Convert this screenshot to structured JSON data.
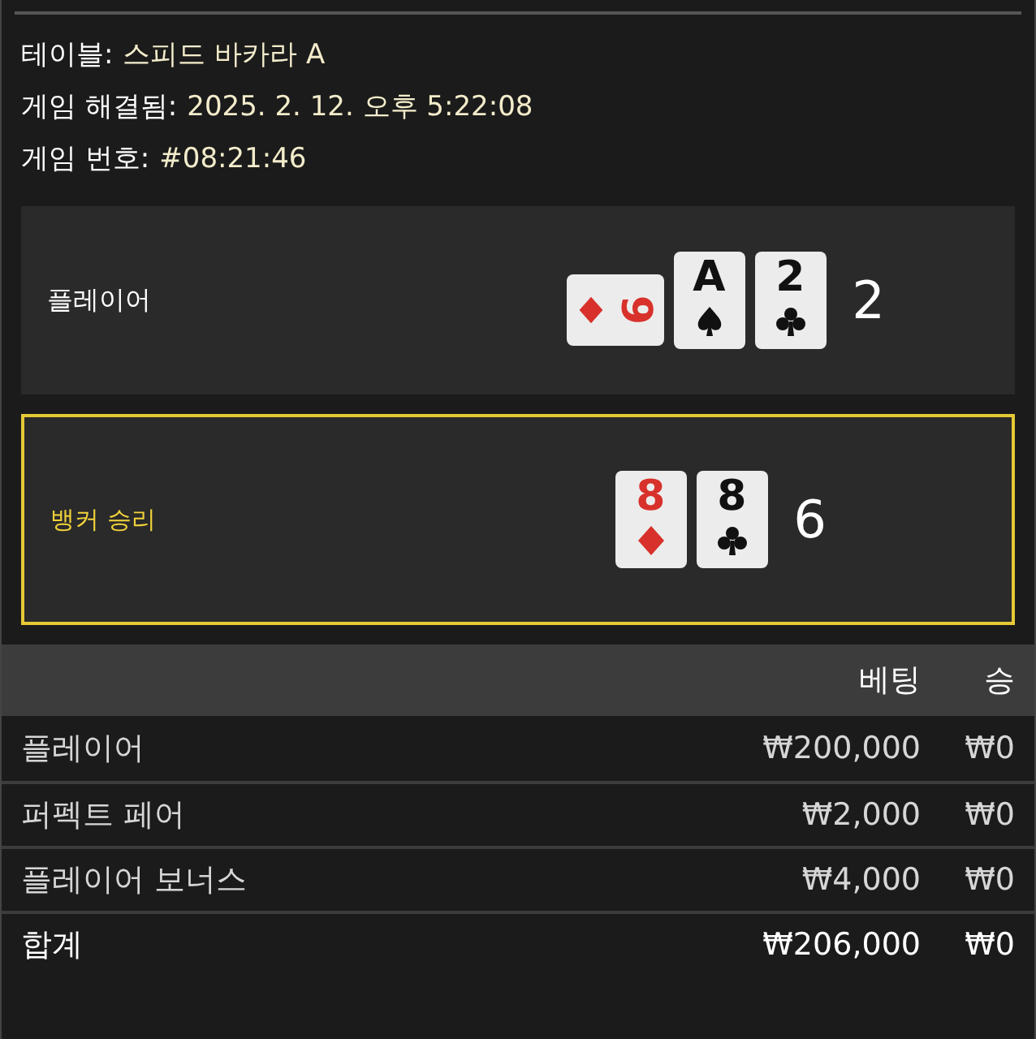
{
  "info": [
    {
      "label": "테이블:",
      "value": "스피드 바카라 A"
    },
    {
      "label": "게임 해결됨:",
      "value": "2025. 2. 12. 오후 5:22:08"
    },
    {
      "label": "게임 번호:",
      "value": "#08:21:46"
    }
  ],
  "hands": [
    {
      "label": "플레이어",
      "winner": false,
      "score": "2",
      "cards": [
        {
          "rank": "6",
          "kind": "diamond",
          "rotated": true
        },
        {
          "rank": "A",
          "kind": "spade",
          "rotated": false
        },
        {
          "rank": "2",
          "kind": "club",
          "rotated": false
        }
      ]
    },
    {
      "label": "뱅커 승리",
      "winner": true,
      "score": "6",
      "cards": [
        {
          "rank": "8",
          "kind": "diamond",
          "rotated": false
        },
        {
          "rank": "8",
          "kind": "club",
          "rotated": false
        }
      ]
    }
  ],
  "table": {
    "columns": [
      "",
      "베팅",
      "승"
    ],
    "rows": [
      {
        "kind": "bet",
        "cells": [
          "플레이어",
          "₩200,000",
          "₩0"
        ]
      },
      {
        "kind": "bet",
        "cells": [
          "퍼펙트 페어",
          "₩2,000",
          "₩0"
        ]
      },
      {
        "kind": "bet",
        "cells": [
          "플레이어 보너스",
          "₩4,000",
          "₩0"
        ]
      },
      {
        "kind": "total",
        "cells": [
          "합계",
          "₩206,000",
          "₩0"
        ]
      }
    ]
  }
}
